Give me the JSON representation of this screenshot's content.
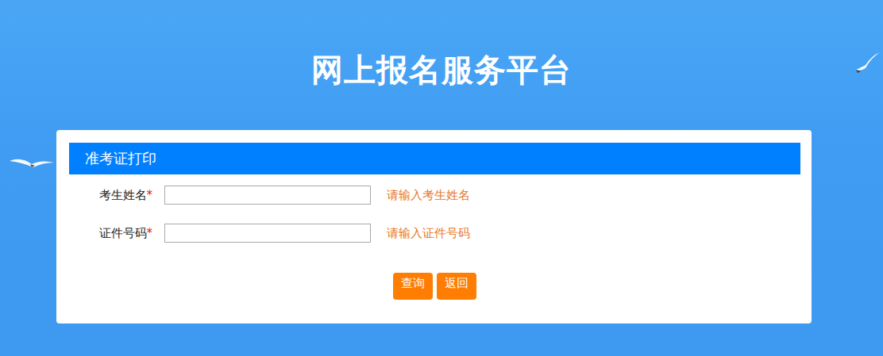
{
  "page": {
    "title": "网上报名服务平台"
  },
  "panel": {
    "title": "准考证打印"
  },
  "fields": [
    {
      "label": "考生姓名",
      "mark": "*",
      "value": "",
      "hint": "请输入考生姓名"
    },
    {
      "label": "证件号码",
      "mark": "*",
      "value": "",
      "hint": "请输入证件号码"
    }
  ],
  "buttons": [
    "查询",
    "返回"
  ]
}
